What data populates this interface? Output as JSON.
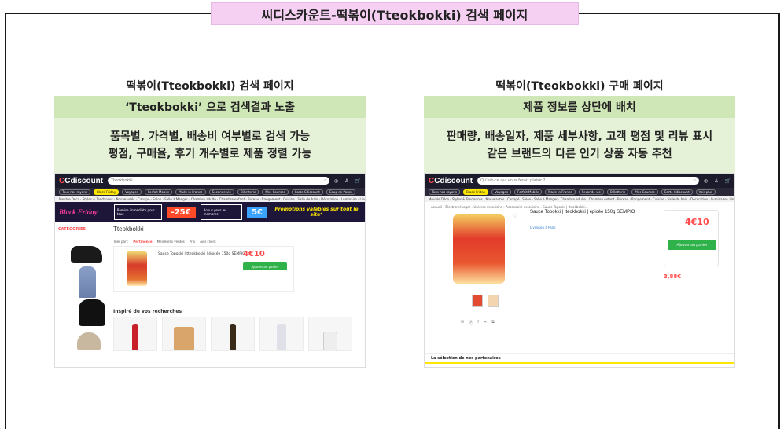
{
  "page_title": "씨디스카운트-떡볶이(Tteokbokki) 검색 페이지",
  "left": {
    "heading": "떡볶이(Tteokbokki) 검색 페이지",
    "summary": "‘Tteokbokki’ 으로 검색결과 노출",
    "details": [
      "품목별, 가격별, 배송비 여부별로 검색 가능",
      "평점, 구매율, 후기 개수별로 제품 정렬 가능"
    ],
    "shot": {
      "logo": "Cdiscount",
      "search_value": "Tteokbokki",
      "nav": [
        "Tous nos rayons",
        "Black Friday",
        "Voyages",
        "Forfait Mobile",
        "Made in France",
        "Seconde vie",
        "Billetterie",
        "Mes Courses",
        "Carte Cdiscount",
        "Coup de Pouce"
      ],
      "sub": "Meuble Déco · Styles & Tendances · Nouveautés · Canapé · Salon · Salle à Manger · Chambre adulte · Chambre enfant · Bureau · Rangement · Cuisine · Salle de bain · Décoration · Luminaire · Linge de maison",
      "banner": {
        "black_friday": "Black Friday",
        "remise": "Remise immédiate pour tous",
        "discount": "-25€",
        "bonus": "Bonus pour les membres",
        "bonus_value": "5€",
        "promo": "Promotions valables sur tout le site*"
      },
      "category_label": "CATÉGORIES",
      "title": "Tteokbokki",
      "sort": [
        "Trier par :",
        "Pertinence",
        "Meilleures ventes",
        "Prix",
        "Avis client"
      ],
      "product_name": "Sauce Topokki | tteokbokki | épicée 150g SEMPIO",
      "product_price": "4€10",
      "add_cart": "Ajouter au panier",
      "inspire": "Inspiré de vos recherches"
    }
  },
  "right": {
    "heading": "떡볶이(Tteokbokki) 구매 페이지",
    "summary": "제품 정보를 상단에 배치",
    "details": [
      "판매량, 배송일자, 제품 세부사항, 고객 평점 및 리뷰 표시",
      "같은 브랜드의 다른 인기 상품 자동 추천"
    ],
    "shot": {
      "logo": "Cdiscount",
      "search_placeholder": "Qu'est-ce qui vous ferait plaisir ?",
      "nav": [
        "Tous nos rayons",
        "Black Friday",
        "Voyages",
        "Forfait Mobile",
        "Made in France",
        "Seconde vie",
        "Billetterie",
        "Mes Courses",
        "Carte Cdiscount",
        "Voir plus"
      ],
      "sub": "Meuble Déco · Styles & Tendances · Nouveautés · Canapé · Salon · Salle à Manger · Chambre adulte · Chambre enfant · Bureau · Rangement · Cuisine · Salle de bain · Décoration · Luminaire · Linge de maison",
      "breadcrumb": "Accueil › Électroménager › Univers de cuisine › Accessoire de cuisine › Sauce Topokki | tteokbokki...",
      "product_title": "Sauce Topokki | tteokbokki | épicée 150g SEMPIO",
      "price": "4€10",
      "add_cart": "Ajouter au panier",
      "deliver_label": "Livraison à Paris",
      "other_price": "3,88€",
      "partners": "La sélection de nos partenaires"
    }
  }
}
